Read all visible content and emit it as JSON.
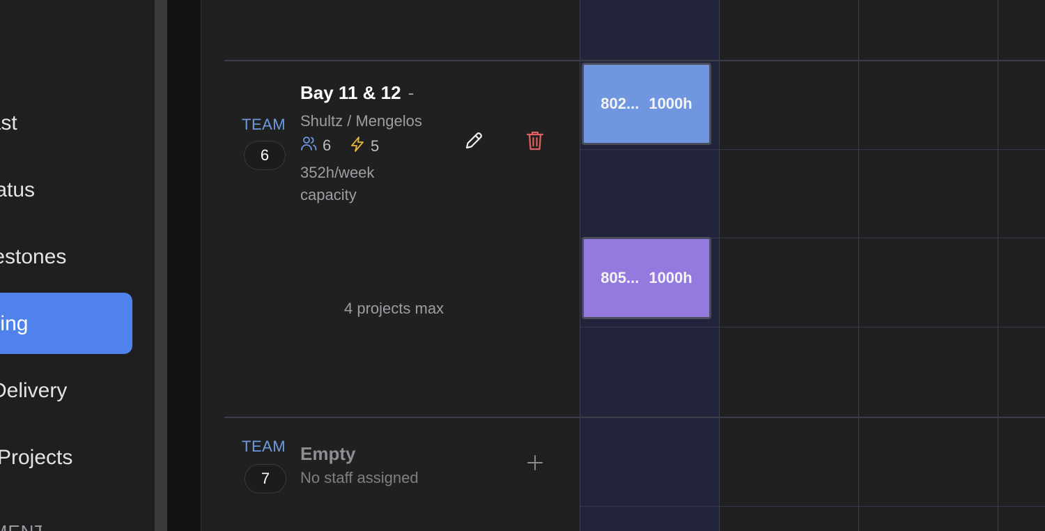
{
  "sidebar": {
    "items": [
      {
        "label": "Forecast"
      },
      {
        "label": "Status"
      },
      {
        "label": "Milestones"
      },
      {
        "label": "Scheduling"
      },
      {
        "label": "Delivery"
      },
      {
        "label": "Projects"
      }
    ],
    "section_label": "MANAGEMENT"
  },
  "teams": [
    {
      "team_label": "TEAM",
      "number": "6",
      "name": "Bay 11 & 12",
      "name_suffix": "-",
      "staff": "Shultz / Mengelos",
      "people_count": "6",
      "power_count": "5",
      "capacity_line1": "352h/week",
      "capacity_line2": "capacity",
      "max_projects": "4 projects max"
    },
    {
      "team_label": "TEAM",
      "number": "7",
      "name": "Empty",
      "staff": "No staff assigned"
    }
  ],
  "schedule_blocks": [
    {
      "code": "802...",
      "hours": "1000h",
      "color": "#7096df"
    },
    {
      "code": "805...",
      "hours": "1000h",
      "color": "#9479df"
    }
  ],
  "icons": {
    "people": "users-icon",
    "power": "lightning-icon",
    "edit": "pencil-icon",
    "delete": "trash-icon",
    "add": "plus-icon"
  },
  "colors": {
    "accent": "#4f82ea",
    "team_label": "#6e9ae0",
    "delete": "#e0605f",
    "power": "#e8b83a"
  }
}
